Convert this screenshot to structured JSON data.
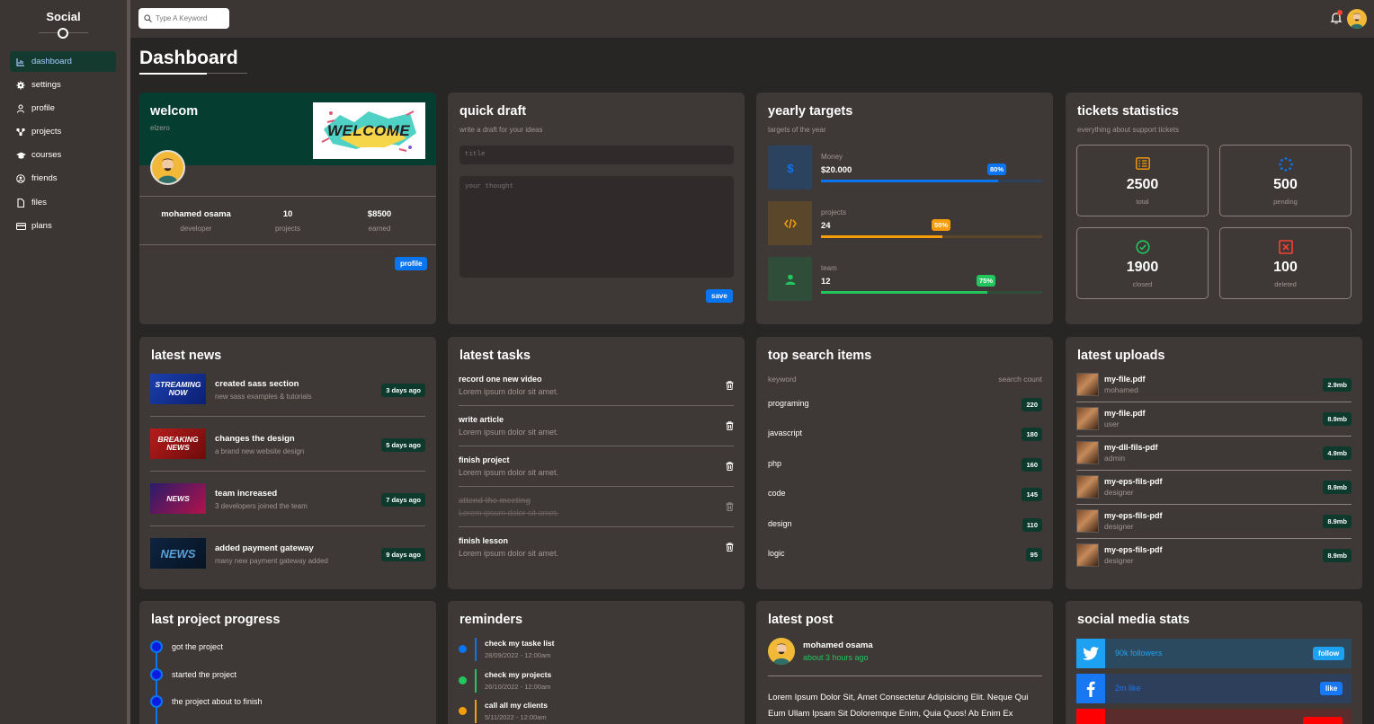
{
  "sidebar": {
    "brand": "Social",
    "items": [
      {
        "label": "dashboard",
        "icon": "chart-icon"
      },
      {
        "label": "settings",
        "icon": "gear-icon"
      },
      {
        "label": "profile",
        "icon": "user-icon"
      },
      {
        "label": "projects",
        "icon": "diagram-icon"
      },
      {
        "label": "courses",
        "icon": "graduation-cap-icon"
      },
      {
        "label": "friends",
        "icon": "user-circle-icon"
      },
      {
        "label": "files",
        "icon": "file-icon"
      },
      {
        "label": "plans",
        "icon": "credit-card-icon"
      }
    ]
  },
  "topbar": {
    "search_placeholder": "Type A Keyword"
  },
  "page_title": "Dashboard",
  "welcome": {
    "title": "welcom",
    "subtitle": "elzero",
    "banner_text": "WELCOME",
    "stats": [
      {
        "value": "mohamed osama",
        "label": "developer"
      },
      {
        "value": "10",
        "label": "projects"
      },
      {
        "value": "$8500",
        "label": "earned"
      }
    ],
    "button": "profile"
  },
  "draft": {
    "title": "quick draft",
    "subtitle": "write a draft for your ideas",
    "title_placeholder": "title",
    "body_placeholder": "your thought",
    "button": "save"
  },
  "targets": {
    "title": "yearly targets",
    "subtitle": "targets of the year",
    "items": [
      {
        "label": "Money",
        "value": "$20.000",
        "percent_label": "80%",
        "percent": 80,
        "color": "#0a75f0",
        "bg": "#2c4360",
        "icon": "dollar-icon"
      },
      {
        "label": "projects",
        "value": "24",
        "percent_label": "55%",
        "percent": 55,
        "color": "#f59e0b",
        "bg": "#5a462b",
        "icon": "code-icon"
      },
      {
        "label": "team",
        "value": "12",
        "percent_label": "75%",
        "percent": 75,
        "color": "#22c55e",
        "bg": "#2f4d39",
        "icon": "user-icon"
      }
    ]
  },
  "tickets": {
    "title": "tickets statistics",
    "subtitle": "everything about support tickets",
    "items": [
      {
        "value": "2500",
        "label": "total",
        "color": "#f59e0b",
        "icon": "list-icon"
      },
      {
        "value": "500",
        "label": "pending",
        "color": "#0a75f0",
        "icon": "spinner-icon"
      },
      {
        "value": "1900",
        "label": "closed",
        "color": "#22c55e",
        "icon": "check-circle-icon"
      },
      {
        "value": "100",
        "label": "deleted",
        "color": "#f44336",
        "icon": "x-square-icon"
      }
    ]
  },
  "news": {
    "title": "latest news",
    "items": [
      {
        "title": "created sass section",
        "desc": "new sass examples & tutorials",
        "badge": "3 days ago",
        "thumb": "STREAMING NOW"
      },
      {
        "title": "changes the design",
        "desc": "a brand new website design",
        "badge": "5 days ago",
        "thumb": "BREAKING NEWS"
      },
      {
        "title": "team increased",
        "desc": "3 developers joined the team",
        "badge": "7 days ago",
        "thumb": "NEWS"
      },
      {
        "title": "added payment gateway",
        "desc": "many new payment gateway added",
        "badge": "9 days ago",
        "thumb": "NEWS"
      }
    ]
  },
  "tasks": {
    "title": "latest tasks",
    "items": [
      {
        "title": "record one new video",
        "desc": "Lorem ipsum dolor sit amet.",
        "done": false
      },
      {
        "title": "write article",
        "desc": "Lorem ipsum dolor sit amet.",
        "done": false
      },
      {
        "title": "finish project",
        "desc": "Lorem ipsum dolor sit amet.",
        "done": false
      },
      {
        "title": "attend the meeting",
        "desc": "Lorem ipsum dolor sit amet.",
        "done": true
      },
      {
        "title": "finish lesson",
        "desc": "Lorem ipsum dolor sit amet.",
        "done": false
      }
    ]
  },
  "search_items": {
    "title": "top search items",
    "col_keyword": "keyword",
    "col_count": "search count",
    "rows": [
      {
        "keyword": "programing",
        "count": "220"
      },
      {
        "keyword": "javascript",
        "count": "180"
      },
      {
        "keyword": "php",
        "count": "160"
      },
      {
        "keyword": "code",
        "count": "145"
      },
      {
        "keyword": "design",
        "count": "110"
      },
      {
        "keyword": "logic",
        "count": "95"
      }
    ]
  },
  "uploads": {
    "title": "latest uploads",
    "items": [
      {
        "name": "my-file.pdf",
        "user": "mohamed",
        "size": "2.9mb"
      },
      {
        "name": "my-file.pdf",
        "user": "user",
        "size": "8.9mb"
      },
      {
        "name": "my-dll-fils-pdf",
        "user": "admin",
        "size": "4.9mb"
      },
      {
        "name": "my-eps-fils-pdf",
        "user": "designer",
        "size": "8.9mb"
      },
      {
        "name": "my-eps-fils-pdf",
        "user": "designer",
        "size": "8.9mb"
      },
      {
        "name": "my-eps-fils-pdf",
        "user": "designer",
        "size": "8.9mb"
      }
    ]
  },
  "progress": {
    "title": "last project progress",
    "steps": [
      "got the project",
      "started the project",
      "the project about to finish"
    ]
  },
  "reminders": {
    "title": "reminders",
    "items": [
      {
        "title": "check my taske list",
        "date": "28/09/2022 - 12:00am",
        "color": "#0a75f0"
      },
      {
        "title": "check my projects",
        "date": "26/10/2022 - 12:00am",
        "color": "#22c55e"
      },
      {
        "title": "call all my clients",
        "date": "5/11/2022 - 12:00am",
        "color": "#f59e0b"
      }
    ]
  },
  "post": {
    "title": "latest post",
    "author": "mohamed osama",
    "time": "about 3 hours ago",
    "body": "Lorem Ipsum Dolor Sit, Amet Consectetur Adipisicing Elit. Neque Qui Eum Ullam Ipsam Sit Doloremque Enim, Quia Quos! Ab Enim Ex"
  },
  "social": {
    "title": "social media stats",
    "items": [
      {
        "network": "twitter",
        "stat": "90k followers",
        "button": "follow",
        "icon": "twitter-icon",
        "color": "#1da1f2",
        "bg": "#2c4a5f"
      },
      {
        "network": "facebook",
        "stat": "2m like",
        "button": "like",
        "icon": "facebook-icon",
        "color": "#1877f2",
        "bg": "#2d3f5b"
      }
    ]
  }
}
